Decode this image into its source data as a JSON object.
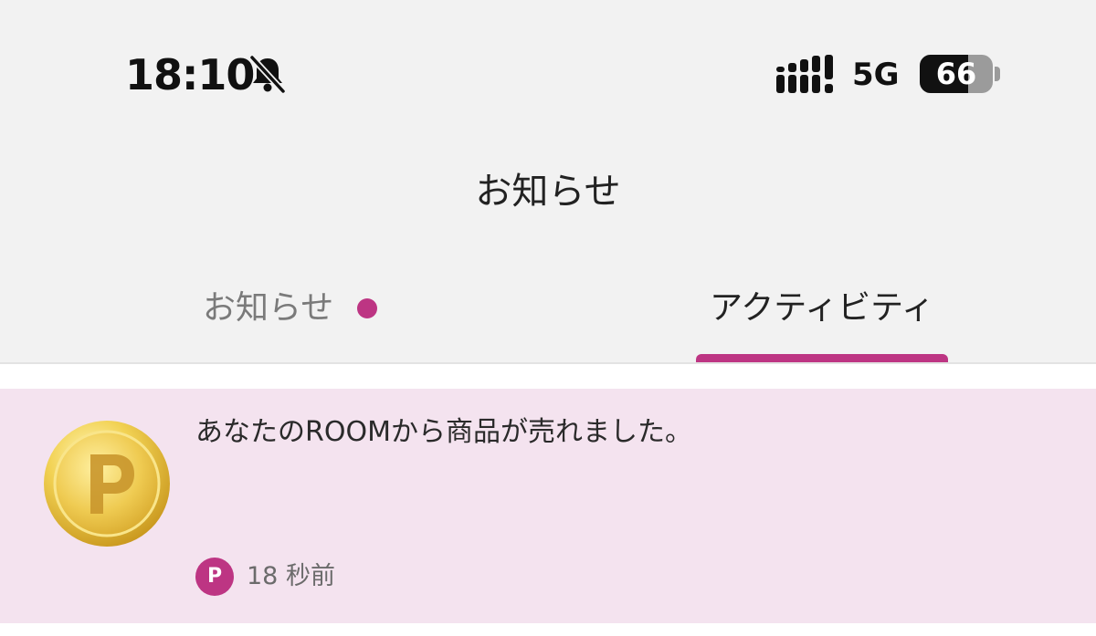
{
  "status_bar": {
    "time": "18:10",
    "network": "5G",
    "battery_level": "66",
    "battery_fraction": 0.66,
    "icons": [
      "bell-slash-icon",
      "cellular-signal-icon",
      "battery-icon"
    ]
  },
  "header": {
    "title": "お知らせ"
  },
  "tabs": [
    {
      "label": "お知らせ",
      "unread_dot": true,
      "active": false
    },
    {
      "label": "アクティビティ",
      "active": true
    }
  ],
  "activity": {
    "items": [
      {
        "icon": "gold-point-coin-icon",
        "message": "あなたのROOMから商品が売れました。",
        "source_icon_letter": "P",
        "timestamp": "18 秒前"
      }
    ]
  },
  "colors": {
    "accent": "#bd3583",
    "header_background": "#f2f2f2",
    "item_highlight": "#f4e3ef"
  }
}
